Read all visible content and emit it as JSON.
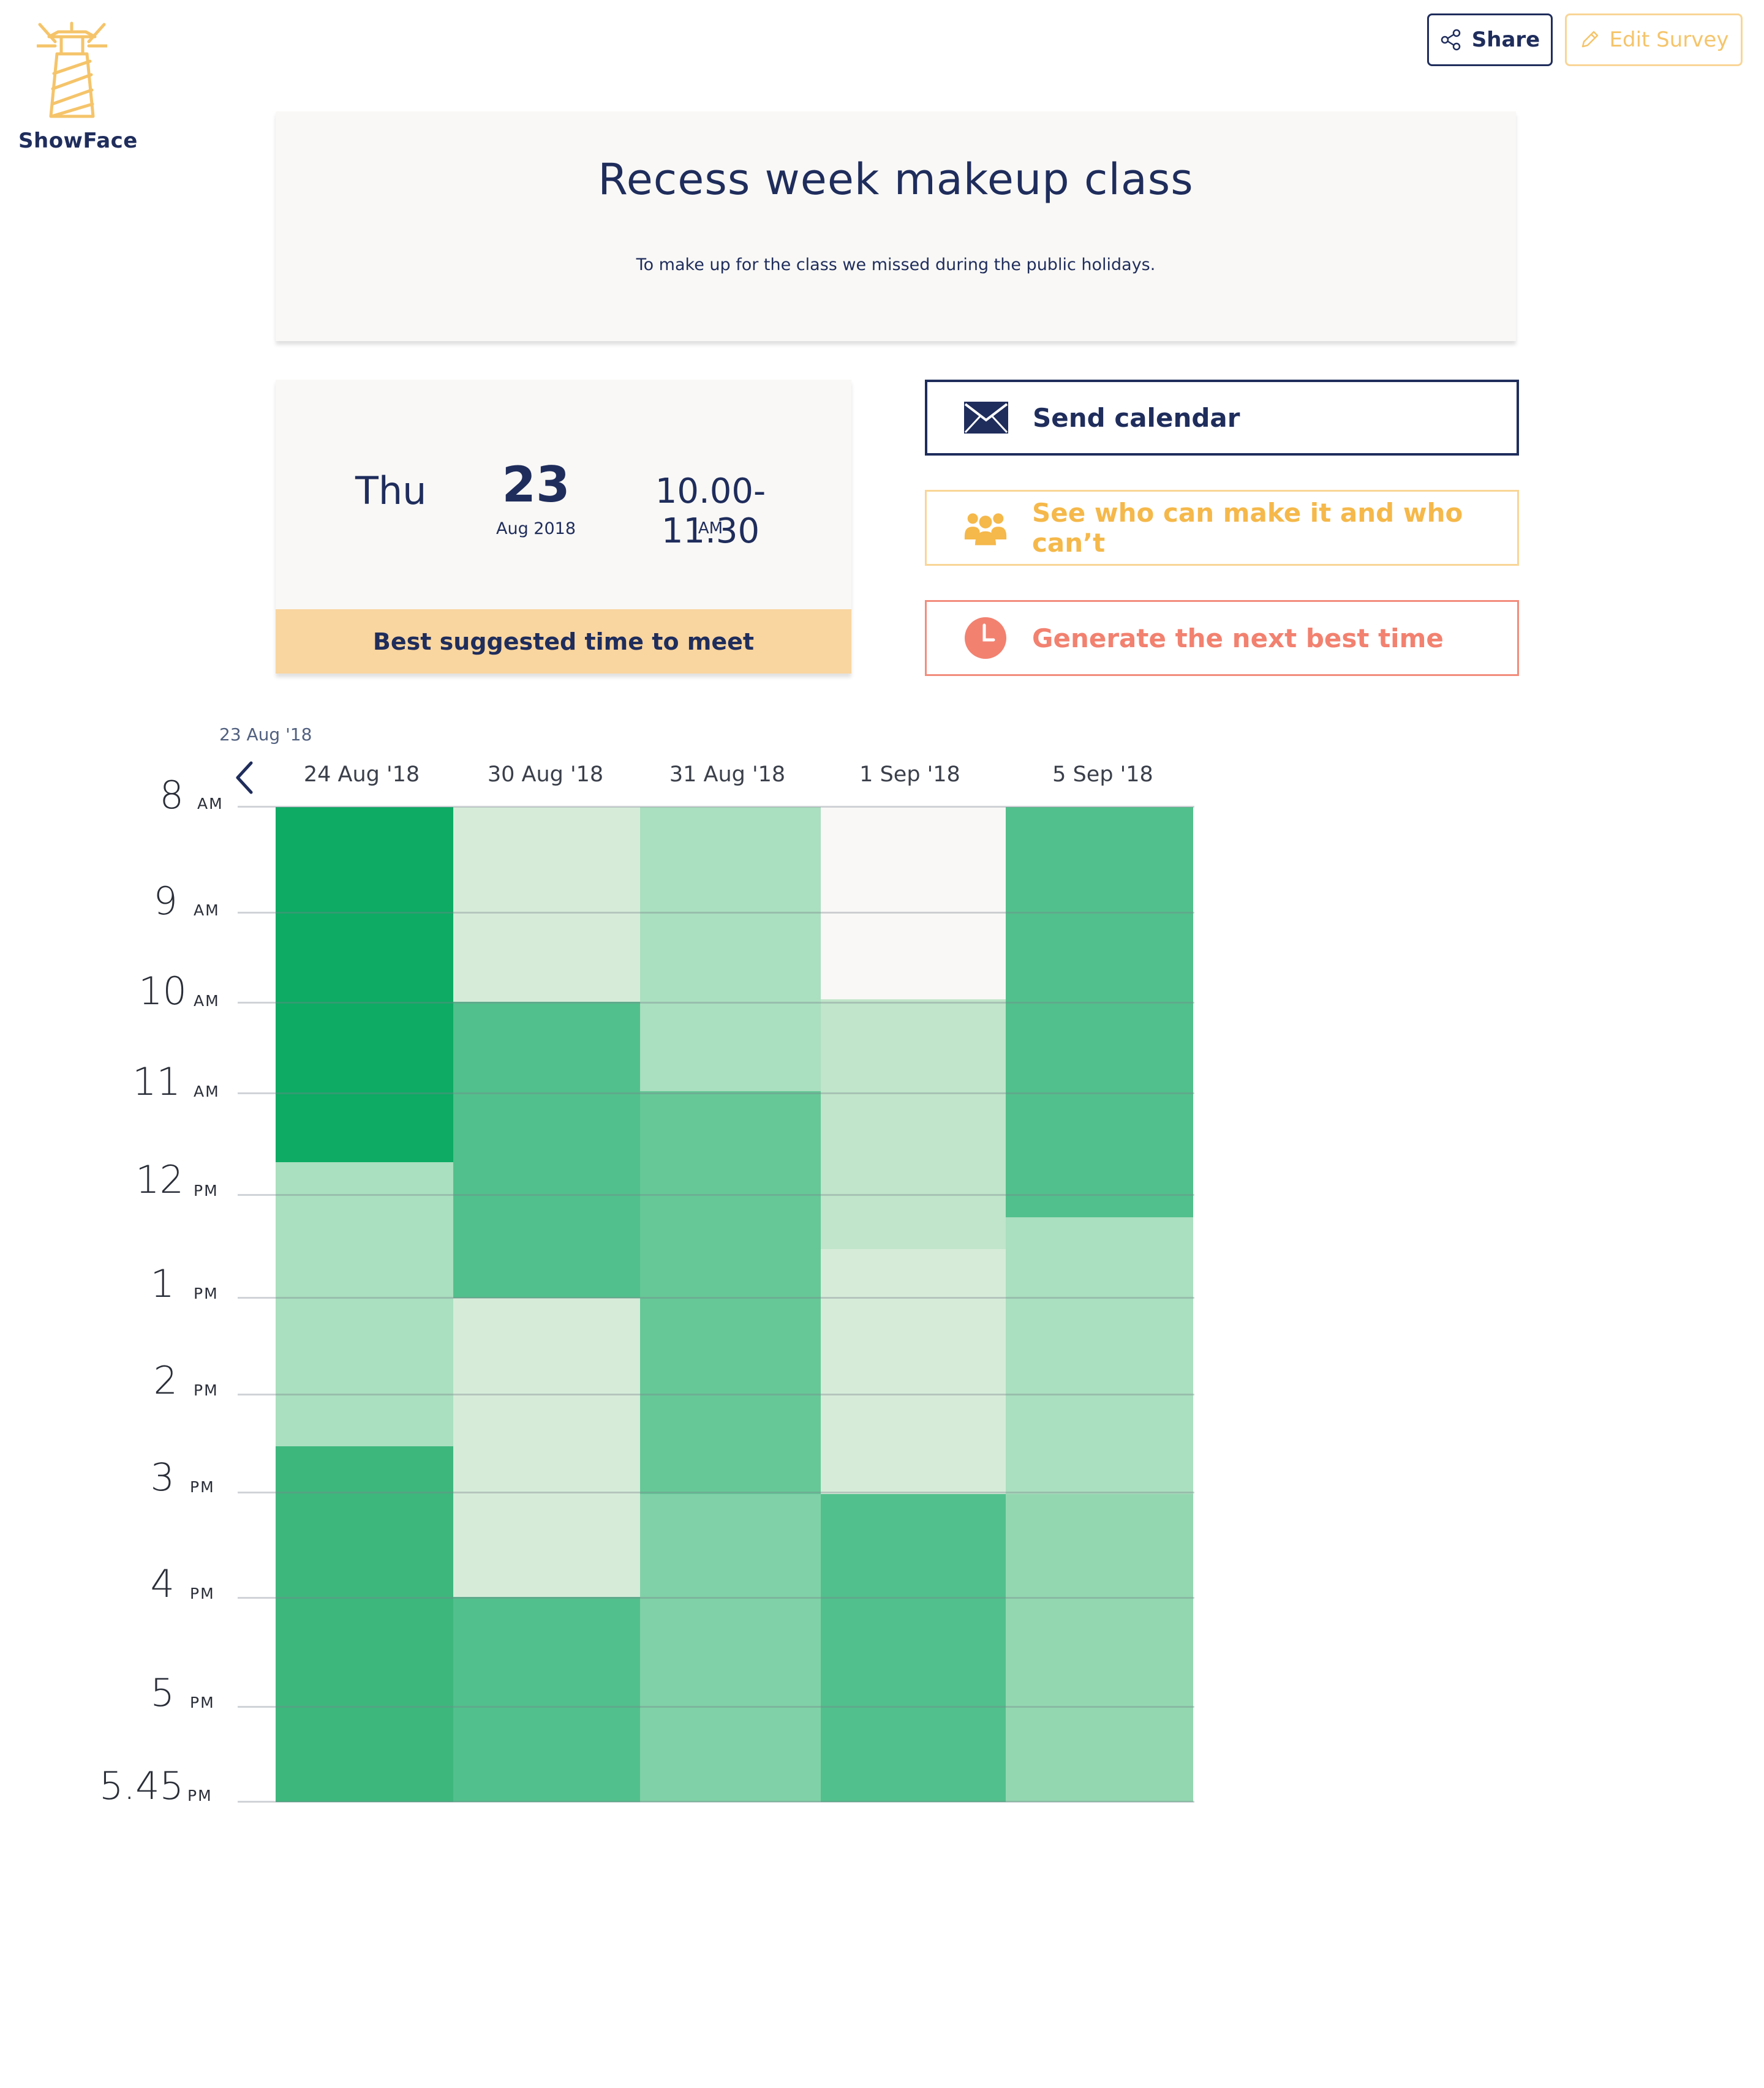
{
  "brand": {
    "name": "ShowFace"
  },
  "toolbar": {
    "share_label": "Share",
    "edit_label": "Edit Survey"
  },
  "survey": {
    "title": "Recess week makeup class",
    "description": "To make up for the class we missed during the public holidays."
  },
  "best_time": {
    "weekday": "Thu",
    "day": "23",
    "month_year": "Aug 2018",
    "time_range": "10.00-11.30",
    "ampm": "AM",
    "caption": "Best suggested time to meet"
  },
  "actions": {
    "send_calendar": "Send calendar",
    "see_who": "See who can make it and who can’t",
    "generate_next": "Generate the next best time"
  },
  "calendar": {
    "current_date_label": "23 Aug '18",
    "columns": [
      "24 Aug '18",
      "30 Aug '18",
      "31 Aug '18",
      "1 Sep '18",
      "5 Sep '18"
    ],
    "rows": [
      {
        "num": "8",
        "ampm": "AM"
      },
      {
        "num": "9",
        "ampm": "AM"
      },
      {
        "num": "10",
        "ampm": "AM"
      },
      {
        "num": "11",
        "ampm": "AM"
      },
      {
        "num": "12",
        "ampm": "PM"
      },
      {
        "num": "1",
        "ampm": "PM"
      },
      {
        "num": "2",
        "ampm": "PM"
      },
      {
        "num": "3",
        "ampm": "PM"
      },
      {
        "num": "4",
        "ampm": "PM"
      },
      {
        "num": "5",
        "ampm": "PM"
      },
      {
        "num": "5.45",
        "ampm": "PM"
      }
    ]
  },
  "colors": {
    "navy": "#1f2d5c",
    "gold": "#f5c46a",
    "coral": "#f28170",
    "heat": [
      "#f9f8f6",
      "#d6ecd9",
      "#c0e5ca",
      "#aadfbf",
      "#93d7b0",
      "#80d1a7",
      "#66c897",
      "#52c08c",
      "#3eb77d",
      "#0dab64"
    ]
  }
}
